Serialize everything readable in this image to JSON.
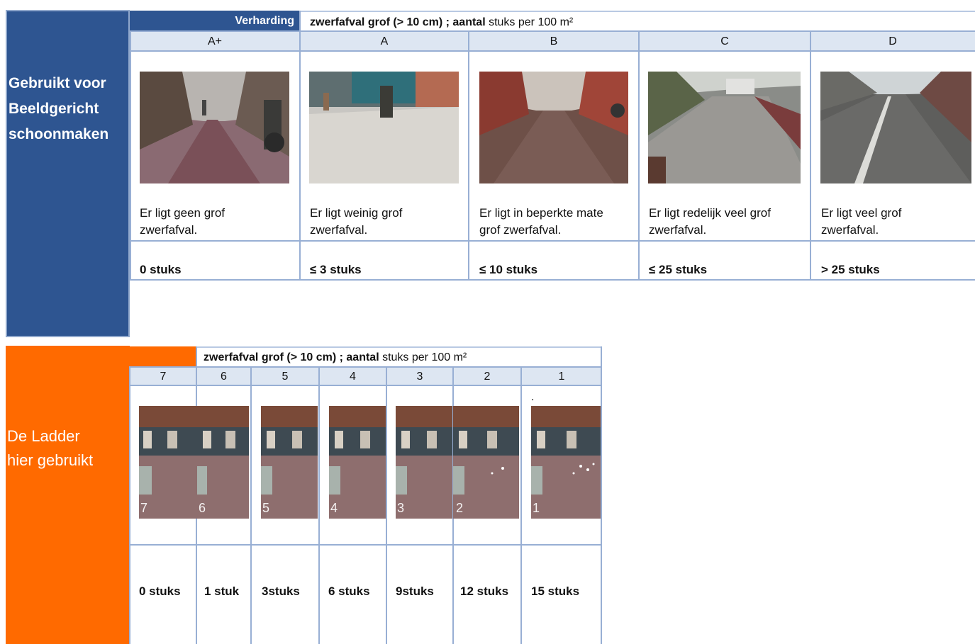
{
  "top": {
    "side_label": [
      "Gebruikt voor",
      "Beeldgericht",
      "schoonmaken"
    ],
    "verharding_label": "Verharding",
    "title_bold": "zwerfafval grof (> 10 cm) ; aantal",
    "title_rest": " stuks per 100 m²",
    "columns": [
      {
        "grade": "A+",
        "desc1": "Er ligt geen grof",
        "desc2": "zwerfafval.",
        "count": "0 stuks"
      },
      {
        "grade": "A",
        "desc1": "Er ligt weinig grof",
        "desc2": "zwerfafval.",
        "count": "≤ 3 stuks"
      },
      {
        "grade": "B",
        "desc1": "Er ligt in beperkte mate",
        "desc2": "grof zwerfafval.",
        "count": "≤ 10 stuks"
      },
      {
        "grade": "C",
        "desc1": "Er ligt redelijk veel grof",
        "desc2": "zwerfafval.",
        "count": "≤ 25 stuks"
      },
      {
        "grade": "D",
        "desc1": "Er ligt veel grof",
        "desc2": "zwerfafval.",
        "count": "> 25 stuks"
      }
    ]
  },
  "bottom": {
    "side_label": [
      "De Ladder",
      "hier gebruikt"
    ],
    "title_bold": "zwerfafval grof (> 10 cm) ; aantal",
    "title_rest": " stuks per 100 m²",
    "dot_mark": ".",
    "columns": [
      {
        "grade": "7",
        "overlay": "7",
        "count": "0 stuks"
      },
      {
        "grade": "6",
        "overlay": "6",
        "count": "1 stuk"
      },
      {
        "grade": "5",
        "overlay": "5",
        "count": "3stuks"
      },
      {
        "grade": "4",
        "overlay": "4",
        "count": "6 stuks"
      },
      {
        "grade": "3",
        "overlay": "3",
        "count": "9stuks"
      },
      {
        "grade": "2",
        "overlay": "2",
        "count": "12 stuks"
      },
      {
        "grade": "1",
        "overlay": "1",
        "count": "15 stuks"
      }
    ]
  },
  "colors": {
    "blue": "#2e5591",
    "orange": "#ff6a00",
    "grid": "#98afd4",
    "header_fill": "#dde6f2"
  }
}
